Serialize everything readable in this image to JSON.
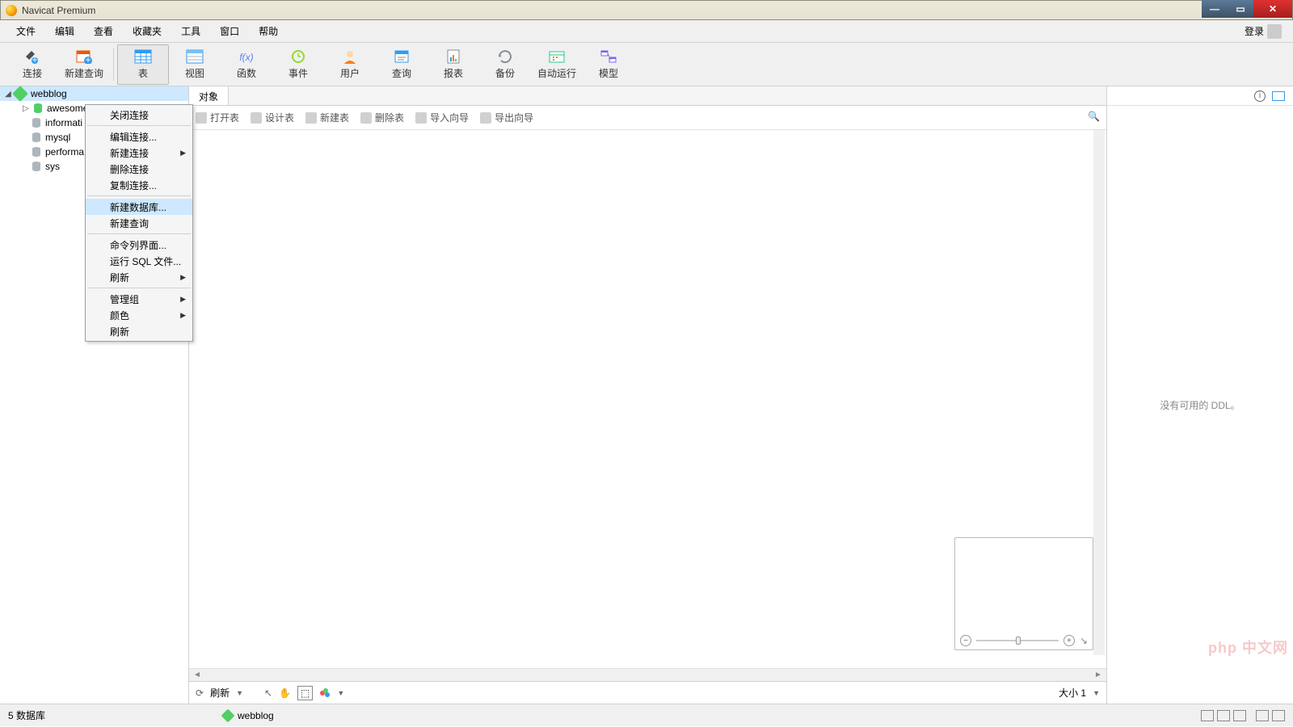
{
  "window": {
    "title": "Navicat Premium"
  },
  "menu": {
    "items": [
      "文件",
      "编辑",
      "查看",
      "收藏夹",
      "工具",
      "窗口",
      "帮助"
    ],
    "login": "登录"
  },
  "toolbar": {
    "items": [
      {
        "label": "连接",
        "name": "connect"
      },
      {
        "label": "新建查询",
        "name": "new-query"
      },
      {
        "label": "表",
        "name": "table",
        "active": true
      },
      {
        "label": "视图",
        "name": "view"
      },
      {
        "label": "函数",
        "name": "function"
      },
      {
        "label": "事件",
        "name": "event"
      },
      {
        "label": "用户",
        "name": "user"
      },
      {
        "label": "查询",
        "name": "query"
      },
      {
        "label": "报表",
        "name": "report"
      },
      {
        "label": "备份",
        "name": "backup"
      },
      {
        "label": "自动运行",
        "name": "autorun"
      },
      {
        "label": "模型",
        "name": "model"
      }
    ]
  },
  "tree": {
    "connection": "webblog",
    "databases": [
      "awesome",
      "informati",
      "mysql",
      "performa",
      "sys"
    ]
  },
  "context_menu": {
    "items": [
      {
        "label": "关闭连接"
      },
      {
        "sep": true
      },
      {
        "label": "编辑连接..."
      },
      {
        "label": "新建连接",
        "sub": true
      },
      {
        "label": "删除连接"
      },
      {
        "label": "复制连接..."
      },
      {
        "sep": true
      },
      {
        "label": "新建数据库...",
        "hl": true
      },
      {
        "label": "新建查询"
      },
      {
        "sep": true
      },
      {
        "label": "命令列界面..."
      },
      {
        "label": "运行 SQL 文件..."
      },
      {
        "label": "刷新",
        "sub": true
      },
      {
        "sep": true
      },
      {
        "label": "管理组",
        "sub": true
      },
      {
        "label": "颜色",
        "sub": true
      },
      {
        "label": "刷新"
      }
    ]
  },
  "tabs": {
    "active": "对象"
  },
  "subtoolbar": {
    "items": [
      {
        "label": "打开表",
        "name": "open-table"
      },
      {
        "label": "设计表",
        "name": "design-table"
      },
      {
        "label": "新建表",
        "name": "new-table"
      },
      {
        "label": "删除表",
        "name": "delete-table"
      },
      {
        "label": "导入向导",
        "name": "import-wizard"
      },
      {
        "label": "导出向导",
        "name": "export-wizard"
      }
    ]
  },
  "rightpane": {
    "placeholder": "没有可用的 DDL。"
  },
  "bottombar": {
    "refresh": "刷新",
    "size": "大小 1"
  },
  "status": {
    "left": "5  数据库",
    "conn": "webblog"
  },
  "watermark": "php 中文网",
  "colors": {
    "accent": "#cde8ff",
    "green": "#51cf66"
  }
}
